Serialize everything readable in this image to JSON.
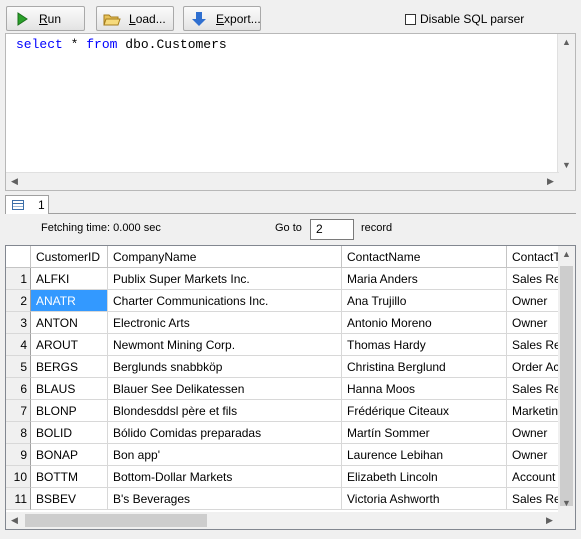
{
  "toolbar": {
    "run_label": "Run",
    "load_label": "Load...",
    "export_label": "Export...",
    "disable_parser_label": "Disable SQL parser",
    "disable_parser_checked": false
  },
  "editor": {
    "kw_select": "select",
    "star": "*",
    "kw_from": "from",
    "object": "dbo.Customers"
  },
  "results": {
    "tab_label": "1",
    "fetching_time": "Fetching time: 0.000 sec",
    "goto_label": "Go to",
    "goto_value": "2",
    "record_label": "record",
    "columns": [
      "CustomerID",
      "CompanyName",
      "ContactName",
      "ContactT"
    ],
    "selected_row": 2,
    "rows": [
      {
        "num": "1",
        "cells": [
          "ALFKI",
          "Publix Super Markets Inc.",
          "Maria Anders",
          "Sales Rep"
        ]
      },
      {
        "num": "2",
        "cells": [
          "ANATR",
          "Charter Communications Inc.",
          "Ana Trujillo",
          "Owner"
        ]
      },
      {
        "num": "3",
        "cells": [
          "ANTON",
          "Electronic Arts",
          "Antonio Moreno",
          "Owner"
        ]
      },
      {
        "num": "4",
        "cells": [
          "AROUT",
          "Newmont Mining Corp.",
          "Thomas Hardy",
          "Sales Rep"
        ]
      },
      {
        "num": "5",
        "cells": [
          "BERGS",
          "Berglunds snabbköp",
          "Christina Berglund",
          "Order Ac"
        ]
      },
      {
        "num": "6",
        "cells": [
          "BLAUS",
          "Blauer See Delikatessen",
          "Hanna Moos",
          "Sales Rep"
        ]
      },
      {
        "num": "7",
        "cells": [
          "BLONP",
          "Blondesddsl père et fils",
          "Frédérique Citeaux",
          "Marketin"
        ]
      },
      {
        "num": "8",
        "cells": [
          "BOLID",
          "Bólido Comidas preparadas",
          "Martín Sommer",
          "Owner"
        ]
      },
      {
        "num": "9",
        "cells": [
          "BONAP",
          "Bon app'",
          "Laurence Lebihan",
          "Owner"
        ]
      },
      {
        "num": "10",
        "cells": [
          "BOTTM",
          "Bottom-Dollar Markets",
          "Elizabeth Lincoln",
          "Account"
        ]
      },
      {
        "num": "11",
        "cells": [
          "BSBEV",
          "B's Beverages",
          "Victoria Ashworth",
          "Sales Rep"
        ]
      }
    ]
  }
}
